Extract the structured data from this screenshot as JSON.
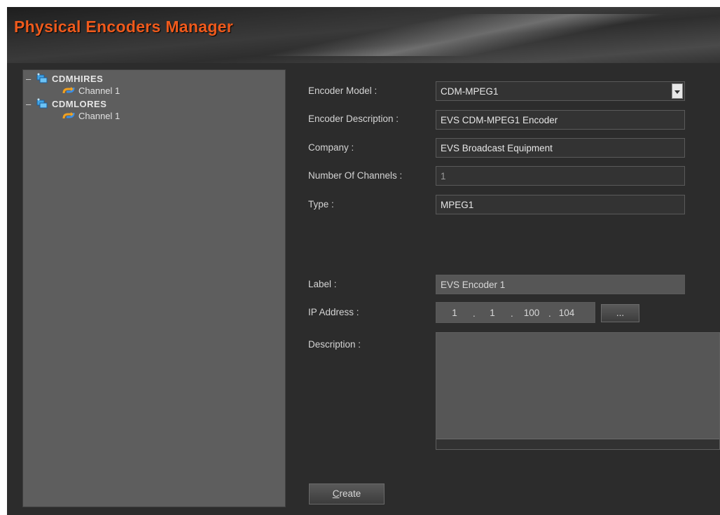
{
  "app": {
    "title": "Physical Encoders Manager"
  },
  "tree": {
    "nodes": [
      {
        "label": "CDMHIRES",
        "collapse": "–",
        "children": [
          {
            "label": "Channel 1"
          }
        ]
      },
      {
        "label": "CDMLORES",
        "collapse": "–",
        "children": [
          {
            "label": "Channel 1"
          }
        ]
      }
    ]
  },
  "form": {
    "encoder_model": {
      "label": "Encoder Model :",
      "value": "CDM-MPEG1"
    },
    "encoder_description": {
      "label": "Encoder Description :",
      "value": "EVS CDM-MPEG1 Encoder"
    },
    "company": {
      "label": "Company :",
      "value": "EVS Broadcast Equipment"
    },
    "number_of_channels": {
      "label": "Number Of Channels :",
      "value": "1"
    },
    "type": {
      "label": "Type :",
      "value": "MPEG1"
    },
    "label": {
      "label": "Label :",
      "value": "EVS Encoder 1"
    },
    "ip_address": {
      "label": "IP Address :",
      "octets": [
        "1",
        "1",
        "100",
        "104"
      ],
      "browse_label": "..."
    },
    "description": {
      "label": "Description :",
      "value": ""
    }
  },
  "actions": {
    "create_label": "Create"
  },
  "colors": {
    "title": "#ef5a1c",
    "panel": "#5e5e5e",
    "background": "#2c2c2c"
  }
}
